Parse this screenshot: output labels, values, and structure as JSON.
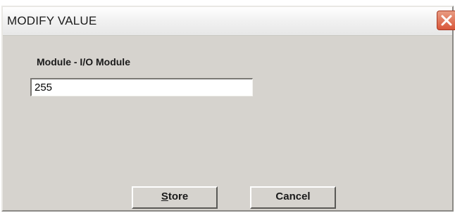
{
  "window": {
    "title": "MODIFY VALUE",
    "close_icon": "close-x-icon"
  },
  "form": {
    "label": "Module - I/O Module",
    "value": "255"
  },
  "buttons": {
    "store_mnemonic": "S",
    "store_rest": "tore",
    "cancel_label": "Cancel"
  },
  "colors": {
    "dialog_background": "#d6d3ce",
    "titlebar_background": "#f1f1f1",
    "close_button": "#d9573a"
  }
}
